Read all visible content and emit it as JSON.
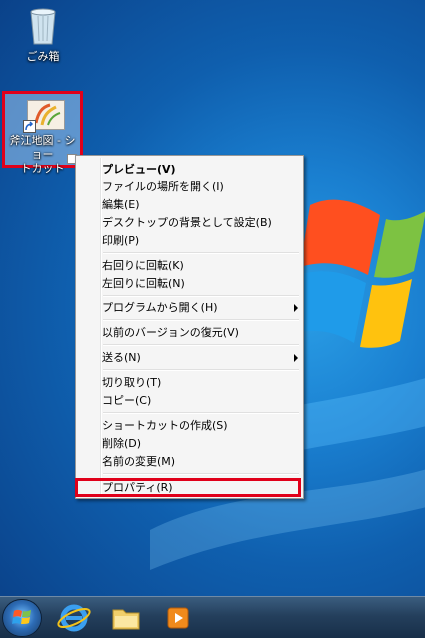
{
  "desktop": {
    "icons": {
      "recycle_bin": {
        "label": "ごみ箱"
      },
      "shortcut": {
        "label_line1": "斧江地図 - ショー",
        "label_line2": "トカット"
      }
    }
  },
  "context_menu": {
    "preview": "プレビュー(V)",
    "open_location": "ファイルの場所を開く(I)",
    "edit": "編集(E)",
    "set_background": "デスクトップの背景として設定(B)",
    "print": "印刷(P)",
    "rotate_right": "右回りに回転(K)",
    "rotate_left": "左回りに回転(N)",
    "open_with": "プログラムから開く(H)",
    "restore_versions": "以前のバージョンの復元(V)",
    "send_to": "送る(N)",
    "cut": "切り取り(T)",
    "copy": "コピー(C)",
    "create_shortcut": "ショートカットの作成(S)",
    "delete": "削除(D)",
    "rename": "名前の変更(M)",
    "properties": "プロパティ(R)"
  },
  "taskbar": {
    "icons": [
      "start-orb-icon",
      "internet-explorer-icon",
      "folder-icon",
      "media-player-icon"
    ]
  },
  "colors": {
    "highlight_border": "#e0001a",
    "desktop_blue": "#1a7fd0",
    "menu_bg": "#f5f5f5"
  }
}
